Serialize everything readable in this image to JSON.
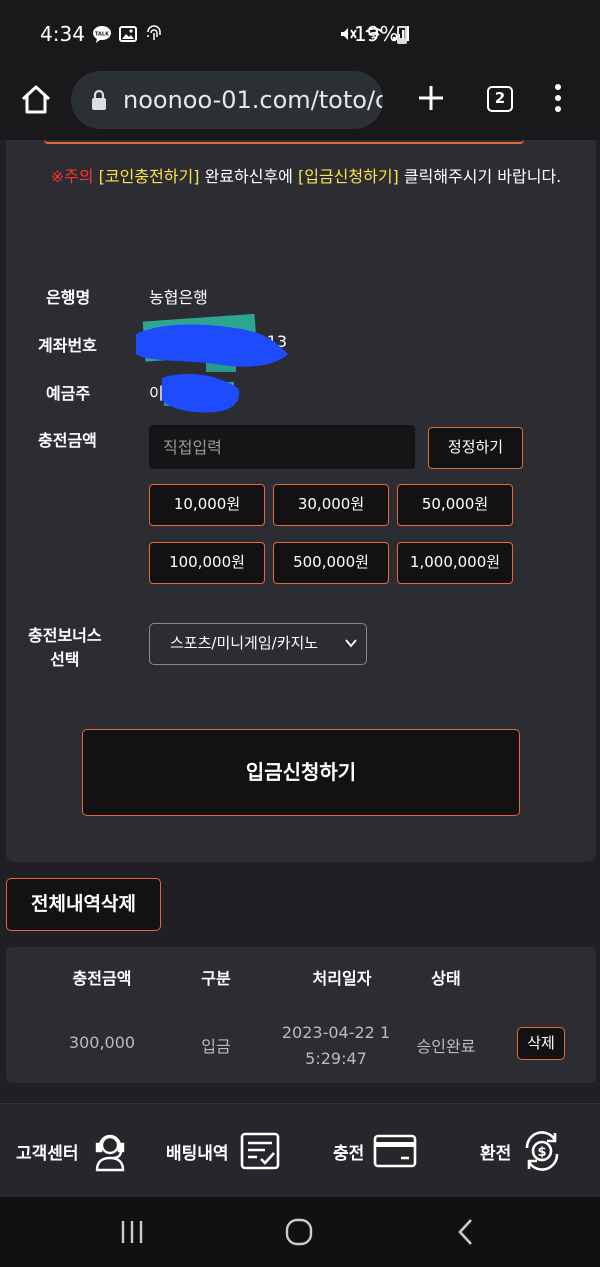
{
  "status_bar": {
    "time": "4:34",
    "battery": "19%"
  },
  "browser": {
    "url": "noonoo-01.com/toto/c",
    "tab_count": "2"
  },
  "notice": {
    "prefix": "※주의",
    "coin": "[코인충전하기]",
    "middle": " 완료하신후에 ",
    "deposit": "[입금신청하기]",
    "suffix": " 클릭해주시기 바랍니다."
  },
  "form": {
    "bank_label": "은행명",
    "bank_value": "농협은행",
    "account_label": "계좌번호",
    "account_value": "301313",
    "holder_label": "예금주",
    "holder_value": "이",
    "amount_label": "충전금액",
    "amount_placeholder": "직접입력",
    "fix_button": "정정하기",
    "amount_buttons": [
      "10,000원",
      "30,000원",
      "50,000원",
      "100,000원",
      "500,000원",
      "1,000,000원"
    ],
    "bonus_label_line1": "충전보너스",
    "bonus_label_line2": "선택",
    "bonus_selected": "스포츠/미니게임/카지노",
    "submit": "입금신청하기"
  },
  "delete_all": "전체내역삭제",
  "history": {
    "headers": [
      "충전금액",
      "구분",
      "처리일자",
      "상태"
    ],
    "rows": [
      {
        "amount": "300,000",
        "type": "입금",
        "date_line1": "2023-04-22 1",
        "date_line2": "5:29:47",
        "status": "승인완료",
        "action": "삭제"
      }
    ]
  },
  "bottom_nav": [
    {
      "label": "고객센터",
      "icon": "headset-agent-icon"
    },
    {
      "label": "배팅내역",
      "icon": "betting-slip-icon"
    },
    {
      "label": "충전",
      "icon": "card-icon"
    },
    {
      "label": "환전",
      "icon": "exchange-dollar-icon"
    }
  ],
  "colors": {
    "accent": "#e5673a",
    "warning_red": "#ff3030",
    "highlight_yellow": "#ffe14a",
    "panel": "#2c2c33",
    "background": "#202024"
  }
}
